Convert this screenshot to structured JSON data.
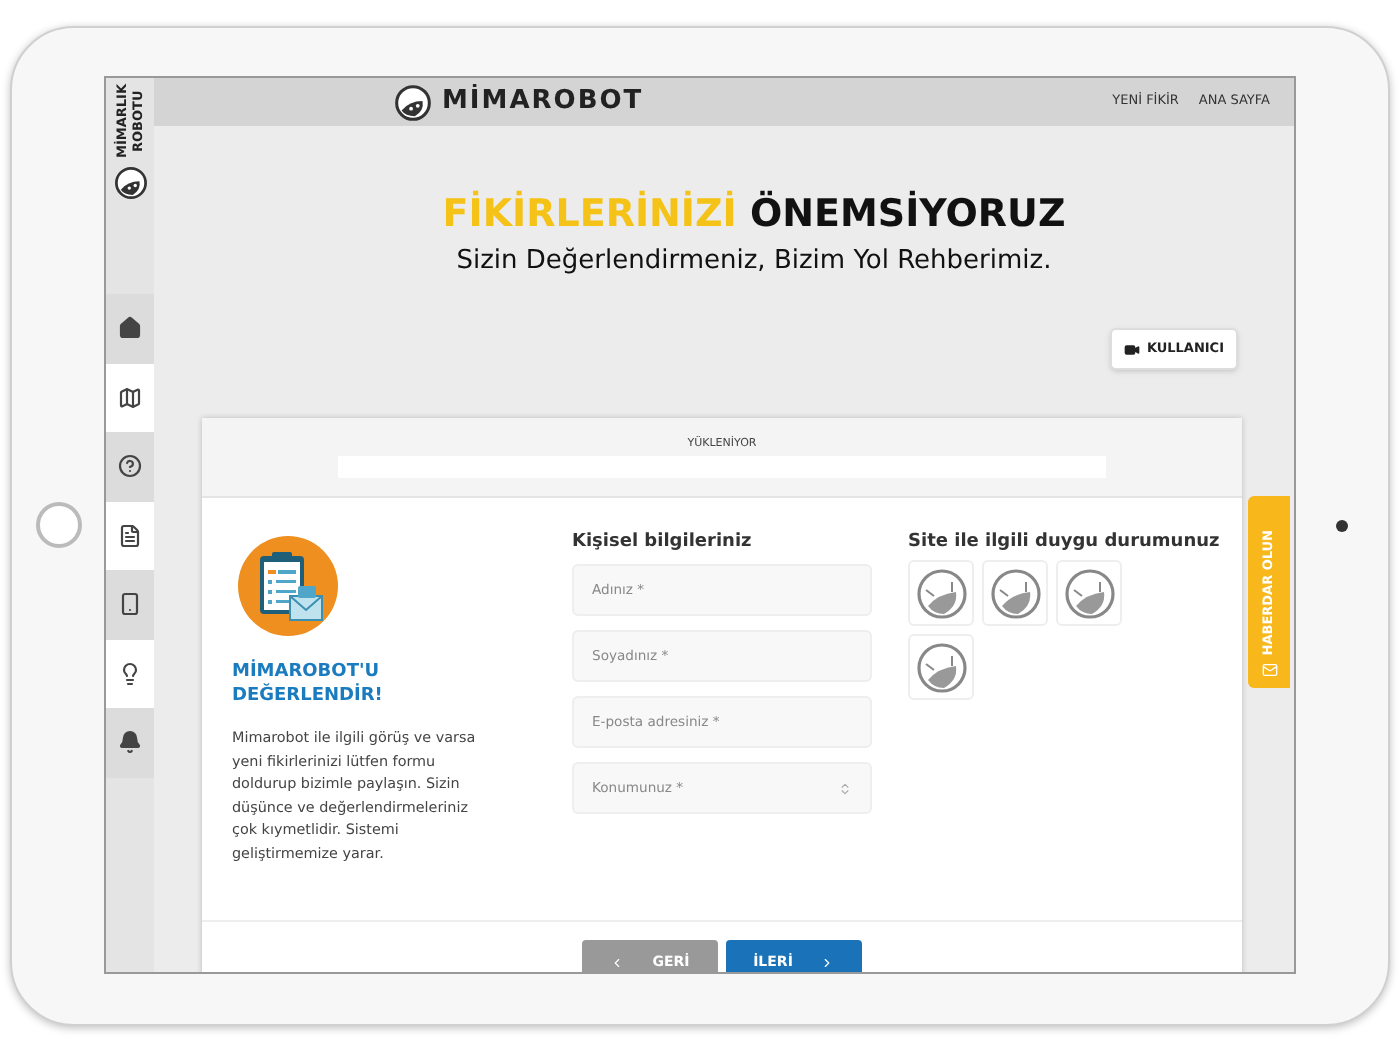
{
  "sidebar": {
    "brand": "MİMARLIK ROBOTU",
    "items": [
      {
        "kind": "home"
      },
      {
        "kind": "map"
      },
      {
        "kind": "help"
      },
      {
        "kind": "document"
      },
      {
        "kind": "phone"
      },
      {
        "kind": "idea"
      },
      {
        "kind": "bell"
      }
    ]
  },
  "header": {
    "logo": "MİMAROBOT",
    "nav": [
      "YENİ FİKİR",
      "ANA SAYFA"
    ]
  },
  "hero": {
    "title_highlight": "FİKİRLERİNİZİ",
    "title_rest": "ÖNEMSİYORUZ",
    "subtitle": "Sizin Değerlendirmeniz, Bizim Yol Rehberimiz."
  },
  "user_button": "KULLANICI",
  "side_tab": "HABERDAR OLUN",
  "card": {
    "progress": {
      "label": "YÜKLENİYOR"
    },
    "intro": {
      "title": "MİMAROBOT'U DEĞERLENDİR!",
      "text": "Mimarobot ile ilgili görüş ve varsa yeni fikirlerinizi lütfen formu doldurup bizimle paylaşın. Sizin düşünce ve değerlendirmeleriniz çok kıymetlidir. Sistemi geliştirmemize yarar."
    },
    "personal": {
      "heading": "Kişisel bilgileriniz",
      "fields": [
        {
          "kind": "text",
          "placeholder": "Adınız *"
        },
        {
          "kind": "text",
          "placeholder": "Soyadınız *"
        },
        {
          "kind": "text",
          "placeholder": "E-posta adresiniz *"
        },
        {
          "kind": "select",
          "placeholder": "Konumunuz *"
        }
      ]
    },
    "mood": {
      "heading": "Site ile ilgili duygu durumunuz",
      "options": [
        {
          "selected": false
        },
        {
          "selected": false
        },
        {
          "selected": false
        },
        {
          "selected": false
        }
      ]
    },
    "buttons": [
      {
        "label": "GERİ",
        "kind": "back",
        "disabled": true
      },
      {
        "label": "İLERİ",
        "kind": "next",
        "disabled": false
      }
    ]
  }
}
